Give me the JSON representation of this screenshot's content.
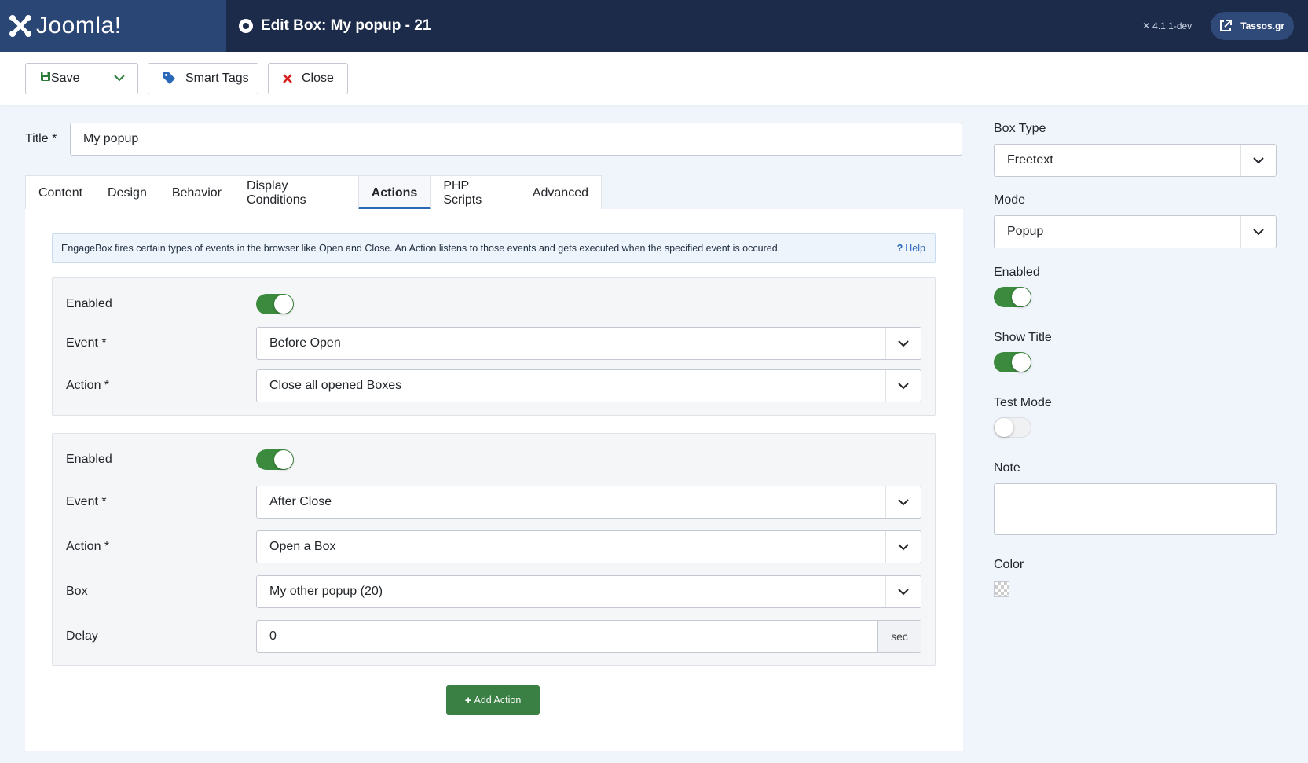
{
  "header": {
    "brand": "Joomla!",
    "page_title": "Edit Box: My popup - 21",
    "version": "4.1.1-dev",
    "site_link": "Tassos.gr"
  },
  "toolbar": {
    "save_label": "Save",
    "smart_tags_label": "Smart Tags",
    "close_label": "Close"
  },
  "form": {
    "title_label": "Title *",
    "title_value": "My popup"
  },
  "tabs": [
    {
      "label": "Content"
    },
    {
      "label": "Design"
    },
    {
      "label": "Behavior"
    },
    {
      "label": "Display Conditions"
    },
    {
      "label": "Actions",
      "active": true
    },
    {
      "label": "PHP Scripts"
    },
    {
      "label": "Advanced"
    }
  ],
  "actions_panel": {
    "info_text": "EngageBox fires certain types of events in the browser like Open and Close. An Action listens to those events and gets executed when the specified event is occured.",
    "help_label": "Help",
    "add_action_label": "Add Action",
    "actions": [
      {
        "enabled_label": "Enabled",
        "enabled": true,
        "event_label": "Event *",
        "event_value": "Before Open",
        "action_label": "Action *",
        "action_value": "Close all opened Boxes"
      },
      {
        "enabled_label": "Enabled",
        "enabled": true,
        "event_label": "Event *",
        "event_value": "After Close",
        "action_label": "Action *",
        "action_value": "Open a Box",
        "box_label": "Box",
        "box_value": "My other popup (20)",
        "delay_label": "Delay",
        "delay_value": "0",
        "delay_unit": "sec"
      }
    ]
  },
  "sidebar": {
    "box_type_label": "Box Type",
    "box_type_value": "Freetext",
    "mode_label": "Mode",
    "mode_value": "Popup",
    "enabled_label": "Enabled",
    "enabled": true,
    "show_title_label": "Show Title",
    "show_title": true,
    "test_mode_label": "Test Mode",
    "test_mode": false,
    "note_label": "Note",
    "note_value": "",
    "color_label": "Color"
  },
  "colors": {
    "header_bg": "#1c2b4a",
    "logo_bg": "#2a4675",
    "toggle_on": "#3c8a3e",
    "add_button": "#3a7f43",
    "link": "#2a69b8",
    "close_icon": "#d92020"
  }
}
